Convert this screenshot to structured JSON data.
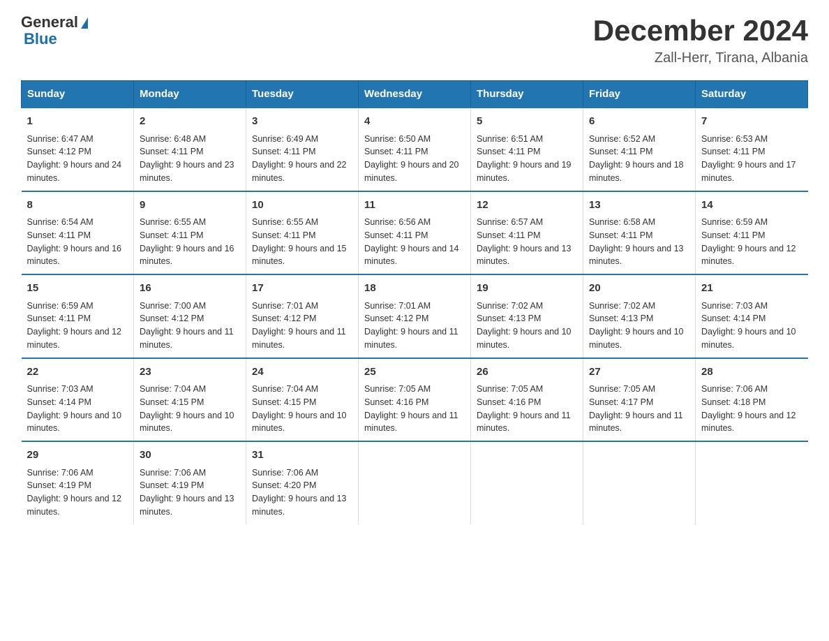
{
  "header": {
    "logo_general": "General",
    "logo_blue": "Blue",
    "month_title": "December 2024",
    "location": "Zall-Herr, Tirana, Albania"
  },
  "days_of_week": [
    "Sunday",
    "Monday",
    "Tuesday",
    "Wednesday",
    "Thursday",
    "Friday",
    "Saturday"
  ],
  "weeks": [
    [
      {
        "day": "1",
        "sunrise": "Sunrise: 6:47 AM",
        "sunset": "Sunset: 4:12 PM",
        "daylight": "Daylight: 9 hours and 24 minutes."
      },
      {
        "day": "2",
        "sunrise": "Sunrise: 6:48 AM",
        "sunset": "Sunset: 4:11 PM",
        "daylight": "Daylight: 9 hours and 23 minutes."
      },
      {
        "day": "3",
        "sunrise": "Sunrise: 6:49 AM",
        "sunset": "Sunset: 4:11 PM",
        "daylight": "Daylight: 9 hours and 22 minutes."
      },
      {
        "day": "4",
        "sunrise": "Sunrise: 6:50 AM",
        "sunset": "Sunset: 4:11 PM",
        "daylight": "Daylight: 9 hours and 20 minutes."
      },
      {
        "day": "5",
        "sunrise": "Sunrise: 6:51 AM",
        "sunset": "Sunset: 4:11 PM",
        "daylight": "Daylight: 9 hours and 19 minutes."
      },
      {
        "day": "6",
        "sunrise": "Sunrise: 6:52 AM",
        "sunset": "Sunset: 4:11 PM",
        "daylight": "Daylight: 9 hours and 18 minutes."
      },
      {
        "day": "7",
        "sunrise": "Sunrise: 6:53 AM",
        "sunset": "Sunset: 4:11 PM",
        "daylight": "Daylight: 9 hours and 17 minutes."
      }
    ],
    [
      {
        "day": "8",
        "sunrise": "Sunrise: 6:54 AM",
        "sunset": "Sunset: 4:11 PM",
        "daylight": "Daylight: 9 hours and 16 minutes."
      },
      {
        "day": "9",
        "sunrise": "Sunrise: 6:55 AM",
        "sunset": "Sunset: 4:11 PM",
        "daylight": "Daylight: 9 hours and 16 minutes."
      },
      {
        "day": "10",
        "sunrise": "Sunrise: 6:55 AM",
        "sunset": "Sunset: 4:11 PM",
        "daylight": "Daylight: 9 hours and 15 minutes."
      },
      {
        "day": "11",
        "sunrise": "Sunrise: 6:56 AM",
        "sunset": "Sunset: 4:11 PM",
        "daylight": "Daylight: 9 hours and 14 minutes."
      },
      {
        "day": "12",
        "sunrise": "Sunrise: 6:57 AM",
        "sunset": "Sunset: 4:11 PM",
        "daylight": "Daylight: 9 hours and 13 minutes."
      },
      {
        "day": "13",
        "sunrise": "Sunrise: 6:58 AM",
        "sunset": "Sunset: 4:11 PM",
        "daylight": "Daylight: 9 hours and 13 minutes."
      },
      {
        "day": "14",
        "sunrise": "Sunrise: 6:59 AM",
        "sunset": "Sunset: 4:11 PM",
        "daylight": "Daylight: 9 hours and 12 minutes."
      }
    ],
    [
      {
        "day": "15",
        "sunrise": "Sunrise: 6:59 AM",
        "sunset": "Sunset: 4:11 PM",
        "daylight": "Daylight: 9 hours and 12 minutes."
      },
      {
        "day": "16",
        "sunrise": "Sunrise: 7:00 AM",
        "sunset": "Sunset: 4:12 PM",
        "daylight": "Daylight: 9 hours and 11 minutes."
      },
      {
        "day": "17",
        "sunrise": "Sunrise: 7:01 AM",
        "sunset": "Sunset: 4:12 PM",
        "daylight": "Daylight: 9 hours and 11 minutes."
      },
      {
        "day": "18",
        "sunrise": "Sunrise: 7:01 AM",
        "sunset": "Sunset: 4:12 PM",
        "daylight": "Daylight: 9 hours and 11 minutes."
      },
      {
        "day": "19",
        "sunrise": "Sunrise: 7:02 AM",
        "sunset": "Sunset: 4:13 PM",
        "daylight": "Daylight: 9 hours and 10 minutes."
      },
      {
        "day": "20",
        "sunrise": "Sunrise: 7:02 AM",
        "sunset": "Sunset: 4:13 PM",
        "daylight": "Daylight: 9 hours and 10 minutes."
      },
      {
        "day": "21",
        "sunrise": "Sunrise: 7:03 AM",
        "sunset": "Sunset: 4:14 PM",
        "daylight": "Daylight: 9 hours and 10 minutes."
      }
    ],
    [
      {
        "day": "22",
        "sunrise": "Sunrise: 7:03 AM",
        "sunset": "Sunset: 4:14 PM",
        "daylight": "Daylight: 9 hours and 10 minutes."
      },
      {
        "day": "23",
        "sunrise": "Sunrise: 7:04 AM",
        "sunset": "Sunset: 4:15 PM",
        "daylight": "Daylight: 9 hours and 10 minutes."
      },
      {
        "day": "24",
        "sunrise": "Sunrise: 7:04 AM",
        "sunset": "Sunset: 4:15 PM",
        "daylight": "Daylight: 9 hours and 10 minutes."
      },
      {
        "day": "25",
        "sunrise": "Sunrise: 7:05 AM",
        "sunset": "Sunset: 4:16 PM",
        "daylight": "Daylight: 9 hours and 11 minutes."
      },
      {
        "day": "26",
        "sunrise": "Sunrise: 7:05 AM",
        "sunset": "Sunset: 4:16 PM",
        "daylight": "Daylight: 9 hours and 11 minutes."
      },
      {
        "day": "27",
        "sunrise": "Sunrise: 7:05 AM",
        "sunset": "Sunset: 4:17 PM",
        "daylight": "Daylight: 9 hours and 11 minutes."
      },
      {
        "day": "28",
        "sunrise": "Sunrise: 7:06 AM",
        "sunset": "Sunset: 4:18 PM",
        "daylight": "Daylight: 9 hours and 12 minutes."
      }
    ],
    [
      {
        "day": "29",
        "sunrise": "Sunrise: 7:06 AM",
        "sunset": "Sunset: 4:19 PM",
        "daylight": "Daylight: 9 hours and 12 minutes."
      },
      {
        "day": "30",
        "sunrise": "Sunrise: 7:06 AM",
        "sunset": "Sunset: 4:19 PM",
        "daylight": "Daylight: 9 hours and 13 minutes."
      },
      {
        "day": "31",
        "sunrise": "Sunrise: 7:06 AM",
        "sunset": "Sunset: 4:20 PM",
        "daylight": "Daylight: 9 hours and 13 minutes."
      },
      {
        "day": "",
        "sunrise": "",
        "sunset": "",
        "daylight": ""
      },
      {
        "day": "",
        "sunrise": "",
        "sunset": "",
        "daylight": ""
      },
      {
        "day": "",
        "sunrise": "",
        "sunset": "",
        "daylight": ""
      },
      {
        "day": "",
        "sunrise": "",
        "sunset": "",
        "daylight": ""
      }
    ]
  ]
}
